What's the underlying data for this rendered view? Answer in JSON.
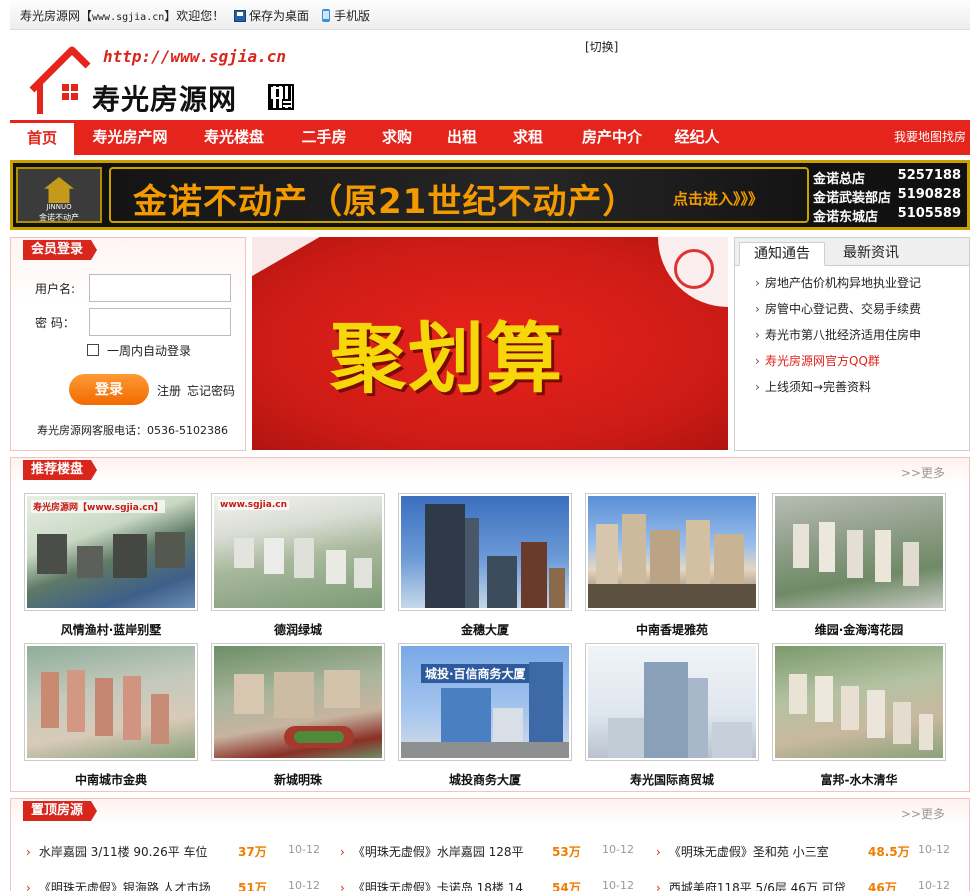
{
  "topbar": {
    "welcome_prefix": "寿光房源网【",
    "welcome_url": "www.sgjia.cn",
    "welcome_suffix": "】欢迎您！",
    "save_desktop": "保存为桌面",
    "mobile": "手机版"
  },
  "switch_label": "[切换]",
  "logo": {
    "url": "http://www.sgjia.cn",
    "name": "寿光房源网"
  },
  "nav": {
    "items": [
      "首页",
      "寿光房产网",
      "寿光楼盘",
      "二手房",
      "求购",
      "出租",
      "求租",
      "房产中介",
      "经纪人"
    ],
    "active": "首页",
    "map_search": "我要地图找房"
  },
  "banner": {
    "brand_en": "JINNUO",
    "brand_cn": "金诺不动产",
    "headline": "金诺不动产（原21世纪不动产）",
    "enter": "点击进入》》》",
    "branches": [
      {
        "name": "金诺总店",
        "phone": "5257188"
      },
      {
        "name": "金诺武装部店",
        "phone": "5190828"
      },
      {
        "name": "金诺东城店",
        "phone": "5105589"
      }
    ]
  },
  "login": {
    "title": "会员登录",
    "username_label": "用户名:",
    "password_label": "密  码：",
    "remember": "一周内自动登录",
    "submit": "登录",
    "register": "注册",
    "forgot": "忘记密码",
    "hotline": "寿光房源网客服电话：0536-5102386"
  },
  "promo": {
    "text": "聚划算"
  },
  "notice": {
    "tabs": [
      "通知通告",
      "最新资讯"
    ],
    "items": [
      {
        "text": "房地产估价机构异地执业登记",
        "hot": false
      },
      {
        "text": "房管中心登记费、交易手续费",
        "hot": false
      },
      {
        "text": "寿光市第八批经济适用住房申",
        "hot": false
      },
      {
        "text": "寿光房源网官方QQ群",
        "hot": true
      },
      {
        "text": "上线须知→完善资料",
        "hot": false
      }
    ]
  },
  "recommend": {
    "title": "推荐楼盘",
    "more": ">>更多",
    "items": [
      {
        "name": "风情渔村·蓝岸别墅",
        "overlay": "寿光房源网【www.sgjia.cn】"
      },
      {
        "name": "德润绿城",
        "overlay": "www.sgjia.cn"
      },
      {
        "name": "金穗大厦",
        "overlay": ""
      },
      {
        "name": "中南香堤雅苑",
        "overlay": ""
      },
      {
        "name": "维园·金海湾花园",
        "overlay": ""
      },
      {
        "name": "中南城市金典",
        "overlay": ""
      },
      {
        "name": "新城明珠",
        "overlay": ""
      },
      {
        "name": "城投商务大厦",
        "overlay": "城投·百信商务大厦"
      },
      {
        "name": "寿光国际商贸城",
        "overlay": ""
      },
      {
        "name": "富邦-水木清华",
        "overlay": ""
      }
    ]
  },
  "top_listings": {
    "title": "置顶房源",
    "more": ">>更多",
    "rows": [
      [
        {
          "title": "水岸嘉园 3/11楼 90.26平 车位",
          "price": "37万",
          "date": "10-12"
        },
        {
          "title": "《明珠无虚假》水岸嘉园 128平",
          "price": "53万",
          "date": "10-12"
        },
        {
          "title": "《明珠无虚假》圣和苑 小三室",
          "price": "48.5万",
          "date": "10-12"
        }
      ],
      [
        {
          "title": "《明珠无虚假》银海路 人才市场",
          "price": "51万",
          "date": "10-12"
        },
        {
          "title": "《明珠无虚假》卡诺岛 18楼 14",
          "price": "54万",
          "date": "10-12"
        },
        {
          "title": "西城美府118平 5/6层 46万 可贷",
          "price": "46万",
          "date": "10-12"
        }
      ]
    ]
  },
  "colors": {
    "brand_red": "#e5241b",
    "price_orange": "#f07c00",
    "banner_gold": "#f39a00"
  }
}
